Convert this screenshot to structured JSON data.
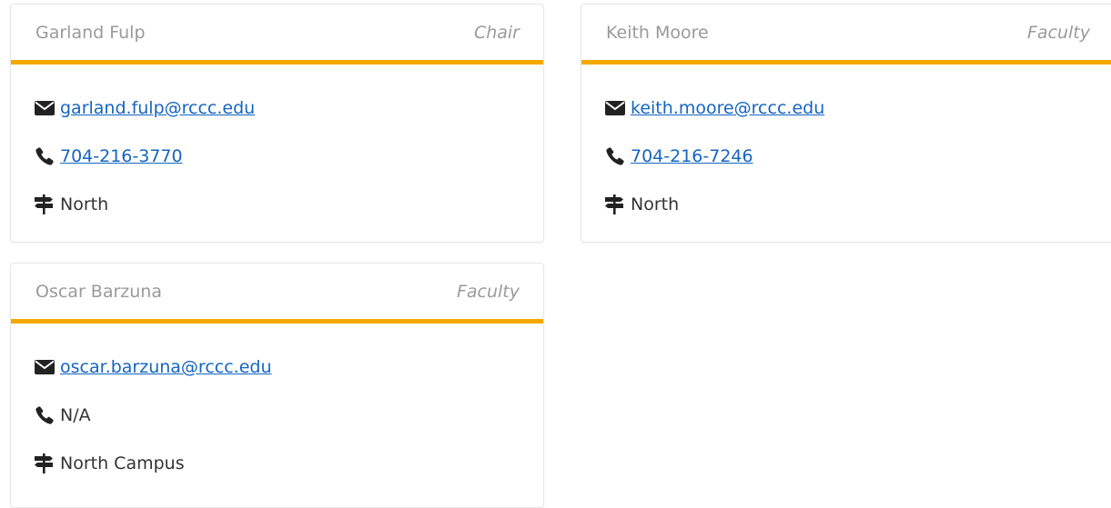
{
  "cards": [
    {
      "name": "Garland Fulp",
      "role": "Chair",
      "email": "garland.fulp@rccc.edu",
      "phone": "704-216-3770",
      "location": "North"
    },
    {
      "name": "Keith Moore",
      "role": "Faculty",
      "email": "keith.moore@rccc.edu",
      "phone": "704-216-7246",
      "location": "North"
    },
    {
      "name": "Oscar Barzuna",
      "role": "Faculty",
      "email": "oscar.barzuna@rccc.edu",
      "phone": "N/A",
      "location": "North Campus"
    }
  ],
  "icons": {
    "email": "envelope-icon",
    "phone": "phone-icon",
    "location": "signpost-icon"
  },
  "colors": {
    "accent": "#f5a800",
    "link": "#1565c0",
    "header_text": "#9a9a9a",
    "body_text": "#333333"
  }
}
